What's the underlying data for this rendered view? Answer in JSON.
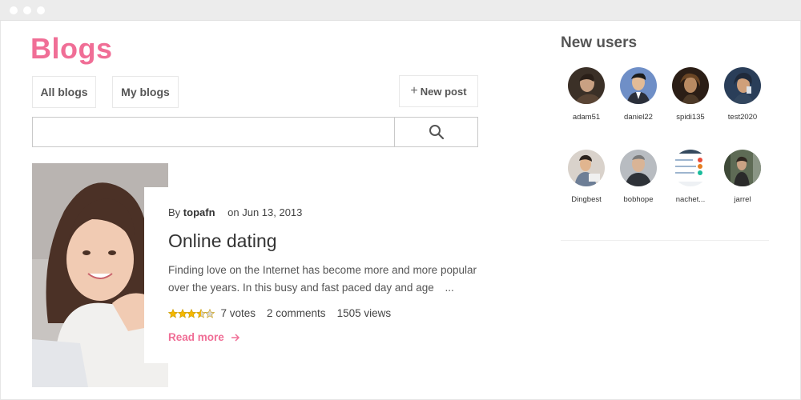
{
  "page": {
    "title": "Blogs"
  },
  "tabs": [
    {
      "label": "All blogs"
    },
    {
      "label": "My blogs"
    }
  ],
  "new_post": {
    "label": "New post",
    "icon": "plus-icon"
  },
  "search": {
    "value": "",
    "placeholder": "",
    "icon": "search-icon"
  },
  "post": {
    "by_label": "By",
    "author": "topafn",
    "date": "on Jun 13, 2013",
    "title": "Online dating",
    "excerpt": "Finding love on the Internet has become more and more popular over the years. In this busy and fast paced day and age",
    "ellipsis": "...",
    "rating": 3.5,
    "rating_max": 5,
    "votes": "7 votes",
    "comments": "2 comments",
    "views": "1505 views",
    "read_more": "Read more",
    "read_more_icon": "arrow-right-icon"
  },
  "sidebar": {
    "title": "New users",
    "users": [
      {
        "name": "adam51"
      },
      {
        "name": "daniel22"
      },
      {
        "name": "spidi135"
      },
      {
        "name": "test2020"
      },
      {
        "name": "Dingbest"
      },
      {
        "name": "bobhope"
      },
      {
        "name": "nachet..."
      },
      {
        "name": "jarrel"
      }
    ]
  },
  "colors": {
    "accent": "#f06e96",
    "star_filled": "#f5b800",
    "star_empty": "#d8d8d8"
  }
}
